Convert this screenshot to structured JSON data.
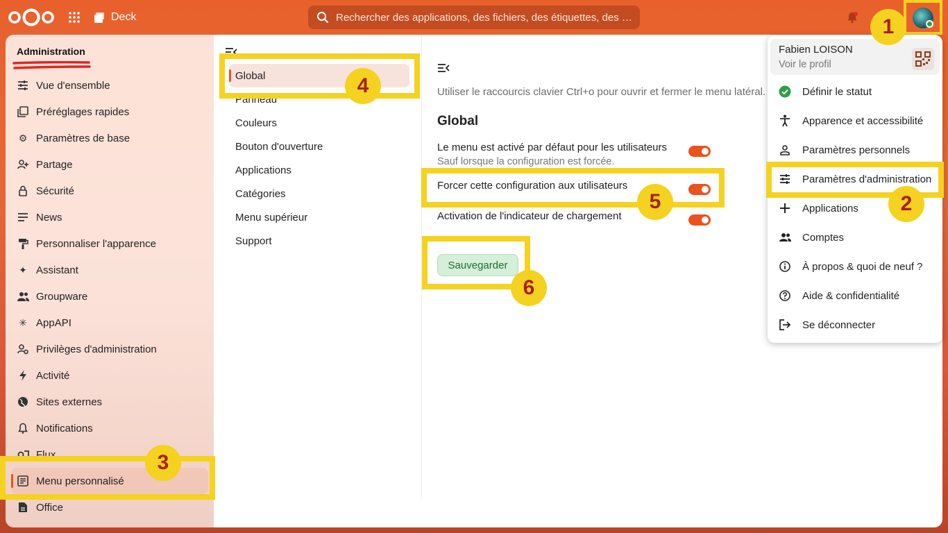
{
  "topbar": {
    "app_name": "Deck",
    "search_placeholder": "Rechercher des applications, des fichiers, des étiquettes, des …"
  },
  "sidebar": {
    "title": "Administration",
    "items": [
      {
        "label": "Vue d'ensemble",
        "icon": "sliders-icon"
      },
      {
        "label": "Préréglages rapides",
        "icon": "presets-icon"
      },
      {
        "label": "Paramètres de base",
        "icon": "gear-icon"
      },
      {
        "label": "Partage",
        "icon": "share-icon"
      },
      {
        "label": "Sécurité",
        "icon": "lock-icon"
      },
      {
        "label": "News",
        "icon": "news-icon"
      },
      {
        "label": "Personnaliser l'apparence",
        "icon": "paint-roller-icon"
      },
      {
        "label": "Assistant",
        "icon": "sparkle-icon"
      },
      {
        "label": "Groupware",
        "icon": "people-icon"
      },
      {
        "label": "AppAPI",
        "icon": "appapi-icon"
      },
      {
        "label": "Privilèges d'administration",
        "icon": "admin-privileges-icon"
      },
      {
        "label": "Activité",
        "icon": "lightning-icon"
      },
      {
        "label": "Sites externes",
        "icon": "globe-icon"
      },
      {
        "label": "Notifications",
        "icon": "bell-icon"
      },
      {
        "label": "Flux",
        "icon": "flux-icon"
      },
      {
        "label": "Menu personnalisé",
        "icon": "custom-menu-icon",
        "active": true
      },
      {
        "label": "Office",
        "icon": "document-icon"
      }
    ]
  },
  "subnav": {
    "items": [
      {
        "label": "Global",
        "active": true
      },
      {
        "label": "Panneau"
      },
      {
        "label": "Couleurs"
      },
      {
        "label": "Bouton d'ouverture"
      },
      {
        "label": "Applications"
      },
      {
        "label": "Catégories"
      },
      {
        "label": "Menu supérieur"
      },
      {
        "label": "Support"
      }
    ]
  },
  "content": {
    "hint": "Utiliser le raccourcis clavier Ctrl+o pour ouvrir et fermer le menu latéral.",
    "section_title": "Global",
    "settings": [
      {
        "label": "Le menu est activé par défaut pour les utilisateurs",
        "sublabel": "Sauf lorsque la configuration est forcée.",
        "enabled": true
      },
      {
        "label": "Forcer cette configuration aux utilisateurs",
        "enabled": true
      },
      {
        "label": "Activation de l'indicateur de chargement",
        "enabled": true
      }
    ],
    "save_label": "Sauvegarder"
  },
  "user_menu": {
    "name": "Fabien LOISON",
    "profile_link": "Voir le profil",
    "items": [
      {
        "label": "Définir le statut",
        "icon": "status-check-icon"
      },
      {
        "label": "Apparence et accessibilité",
        "icon": "accessibility-icon"
      },
      {
        "label": "Paramètres personnels",
        "icon": "user-icon"
      },
      {
        "label": "Paramètres d'administration",
        "icon": "sliders-icon"
      },
      {
        "label": "Applications",
        "icon": "plus-icon"
      },
      {
        "label": "Comptes",
        "icon": "accounts-icon"
      },
      {
        "label": "À propos & quoi de neuf ?",
        "icon": "info-icon"
      },
      {
        "label": "Aide & confidentialité",
        "icon": "help-icon"
      },
      {
        "label": "Se déconnecter",
        "icon": "logout-icon"
      }
    ]
  },
  "annotations": [
    "1",
    "2",
    "3",
    "4",
    "5",
    "6"
  ],
  "colors": {
    "accent": "#e9531f",
    "highlight": "#f4d21f",
    "annotation_text": "#a8201a",
    "save_button": "#d5efd9"
  }
}
